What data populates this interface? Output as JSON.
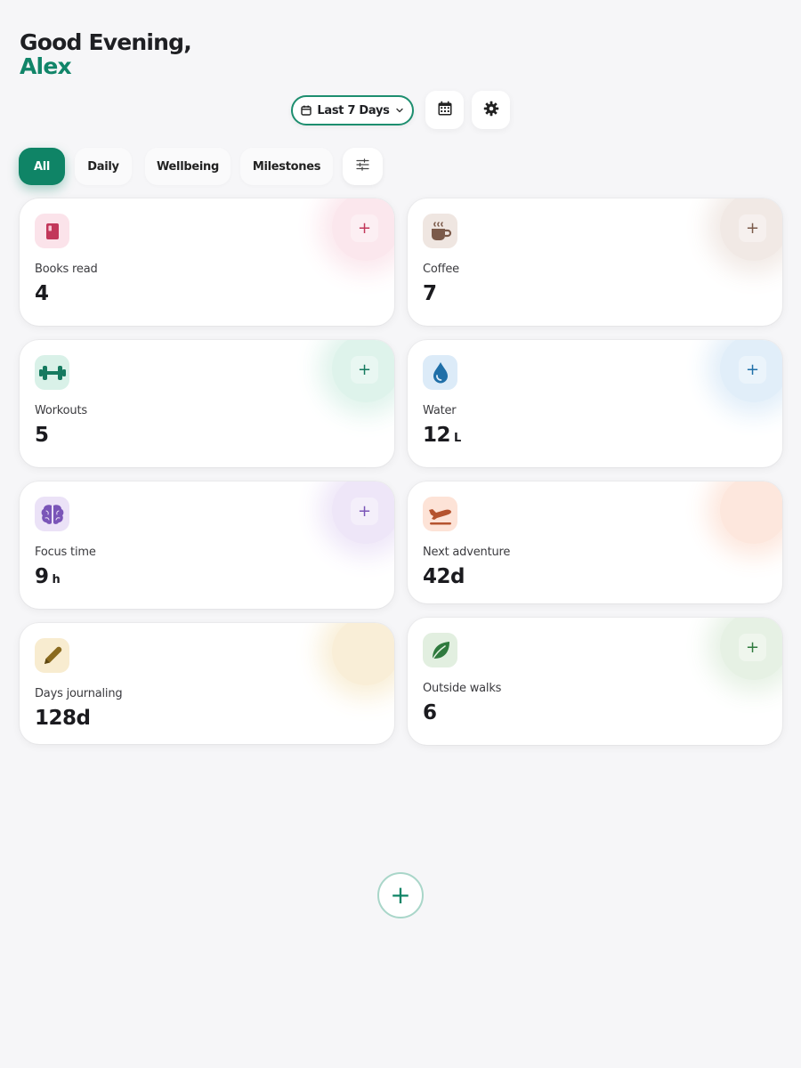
{
  "greeting": {
    "line1": "Good Evening,",
    "name": "Alex"
  },
  "controls": {
    "range_label": "Last 7 Days",
    "calendar_icon": "calendar-grid-icon",
    "settings_icon": "gear-icon"
  },
  "filters": [
    {
      "label": "All",
      "active": true
    },
    {
      "label": "Daily",
      "active": false
    },
    {
      "label": "Wellbeing",
      "active": false
    },
    {
      "label": "Milestones",
      "active": false
    }
  ],
  "filter_options_icon": "sliders-icon",
  "cards": [
    {
      "label": "Books read",
      "value": "4",
      "unit": "",
      "icon": "book-icon",
      "accent": "#c2375a",
      "tint": "#fbe3ea",
      "has_add": true
    },
    {
      "label": "Coffee",
      "value": "7",
      "unit": "",
      "icon": "coffee-cup-icon",
      "accent": "#7b5a4a",
      "tint": "#efe6e1",
      "has_add": true
    },
    {
      "label": "Workouts",
      "value": "5",
      "unit": "",
      "icon": "dumbbell-icon",
      "accent": "#157a5f",
      "tint": "#d9f1e8",
      "has_add": true
    },
    {
      "label": "Water",
      "value": "12",
      "unit": "L",
      "icon": "water-drop-icon",
      "accent": "#1f6fa8",
      "tint": "#dcebf8",
      "has_add": true
    },
    {
      "label": "Focus time",
      "value": "9",
      "unit": "h",
      "icon": "brain-icon",
      "accent": "#7a55b8",
      "tint": "#ebe2f7",
      "has_add": true
    },
    {
      "label": "Next adventure",
      "value": "42d",
      "unit": "",
      "icon": "airplane-icon",
      "accent": "#b5532e",
      "tint": "#fde3d7",
      "has_add": false
    },
    {
      "label": "Days journaling",
      "value": "128d",
      "unit": "",
      "icon": "pencil-icon",
      "accent": "#8a6a1e",
      "tint": "#f8ecd0",
      "has_add": false
    },
    {
      "label": "Outside walks",
      "value": "6",
      "unit": "",
      "icon": "leaf-icon",
      "accent": "#2f7a3e",
      "tint": "#e2efe0",
      "has_add": true
    }
  ],
  "add_symbol": "+",
  "fab_symbol": "+",
  "colors": {
    "brand": "#0f8466",
    "background": "#f6f6f8"
  }
}
